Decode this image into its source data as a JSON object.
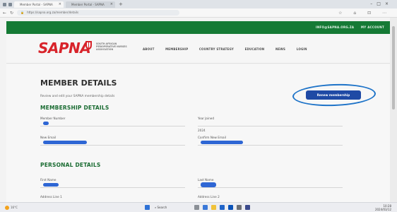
{
  "browser": {
    "tabs": [
      {
        "label": "Member Portal - SAPNA"
      },
      {
        "label": "Member Portal - SAPNA"
      }
    ],
    "url": "https://sapna.org.za/member/details"
  },
  "site": {
    "top_links": [
      "INFO@SAPNA.ORG.ZA",
      "MY ACCOUNT"
    ],
    "logo": "SAPNA",
    "logo_subtitle": "SOUTH AFRICAN PERIOPERATIVE NURSES ASSOCIATION",
    "nav": [
      "ABOUT",
      "MEMBERSHIP",
      "COUNTRY STRATEGY",
      "EDUCATION",
      "NEWS",
      "LOGIN"
    ]
  },
  "page": {
    "title": "MEMBER DETAILS",
    "description": "Review and edit your SAPNA membership details",
    "renew_button": "Renew membership",
    "membership_section": "MEMBERSHIP DETAILS",
    "member_number_label": "Member Number",
    "year_joined_label": "Year Joined",
    "year_joined_value": "2024",
    "new_email_label": "New Email",
    "confirm_email_label": "Confirm New Email",
    "personal_section": "PERSONAL DETAILS",
    "first_name_label": "First Name",
    "last_name_label": "Last Name",
    "address1_label": "Address Line 1",
    "address2_label": "Address Line 2"
  },
  "taskbar": {
    "weather": "16°C",
    "search": "Search",
    "time": "10:28",
    "date": "2024/03/12"
  },
  "colors": {
    "brand_green": "#157a35",
    "logo_red": "#d8232a",
    "button_blue": "#1f4aa5",
    "annotation_blue": "#1d73c8"
  }
}
